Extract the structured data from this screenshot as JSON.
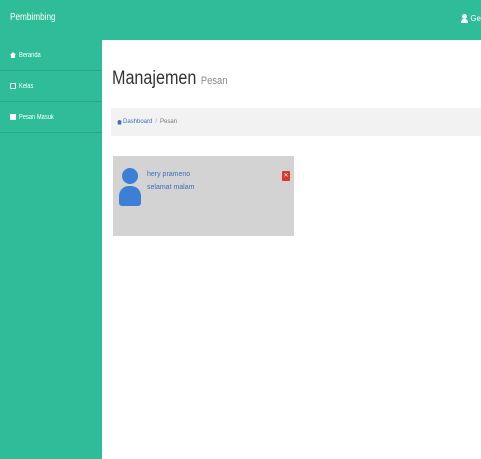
{
  "app": {
    "brand": "Pembimbing",
    "user_label": "Ge"
  },
  "sidebar": {
    "items": [
      {
        "label": "Beranda",
        "icon": "home-icon"
      },
      {
        "label": "Kelas",
        "icon": "class-icon"
      },
      {
        "label": "Pesan Masuk",
        "icon": "inbox-icon"
      }
    ]
  },
  "page": {
    "title": "Manajemen",
    "subtitle": "Pesan"
  },
  "breadcrumb": {
    "home": "Dashboard",
    "current": "Pesan"
  },
  "messages": [
    {
      "sender": "hery prameno",
      "text": "selamat malam"
    }
  ],
  "colors": {
    "accent": "#2ebd98",
    "link": "#3c6fbf",
    "delete": "#d9372f",
    "card": "#d3d3d3"
  }
}
